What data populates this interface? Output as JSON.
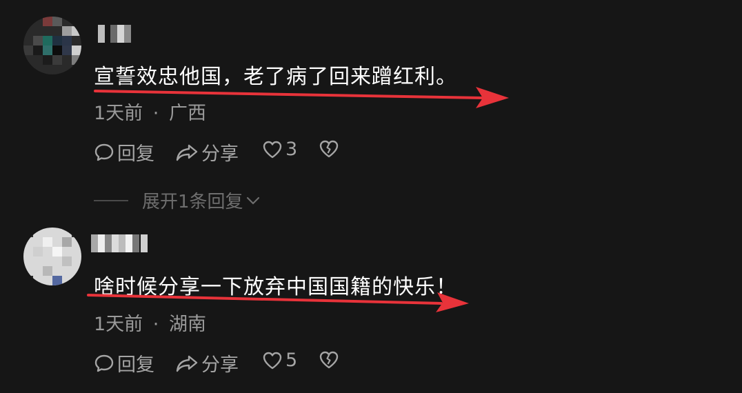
{
  "comments": [
    {
      "text": "宣誓效忠他国，老了病了回来蹭红利。",
      "time": "1天前",
      "separator": "·",
      "location": "广西",
      "reply_label": "回复",
      "share_label": "分享",
      "like_count": "3",
      "expand_label": "展开1条回复"
    },
    {
      "text": "啥时候分享一下放弃中国国籍的快乐！",
      "time": "1天前",
      "separator": "·",
      "location": "湖南",
      "reply_label": "回复",
      "share_label": "分享",
      "like_count": "5"
    }
  ],
  "colors": {
    "background": "#161616",
    "text": "#ffffff",
    "meta": "#9a9a9a",
    "annotation_arrow": "#e8333a"
  },
  "icons": [
    "comment-bubble-icon",
    "share-arrow-icon",
    "heart-icon",
    "broken-heart-icon",
    "chevron-down-icon"
  ]
}
